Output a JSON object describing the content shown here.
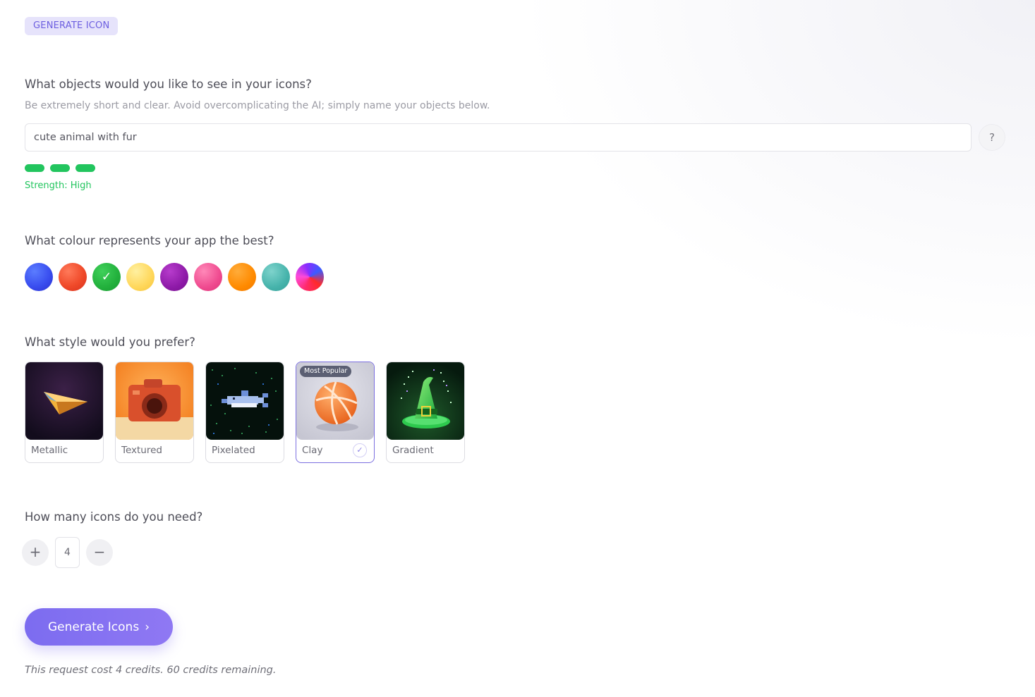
{
  "header": {
    "badge": "GENERATE ICON"
  },
  "objects": {
    "question": "What objects would you like to see in your icons?",
    "hint": "Be extremely short and clear. Avoid overcomplicating the AI; simply name your objects below.",
    "value": "cute animal with fur",
    "help_label": "?",
    "strength_label": "Strength: High",
    "strength_level": 3
  },
  "colour": {
    "question": "What colour represents your app the best?",
    "swatches": [
      {
        "name": "blue",
        "color": "#3a4ff0"
      },
      {
        "name": "red",
        "color": "#f04a2a"
      },
      {
        "name": "green",
        "color": "#22b03c",
        "selected": true
      },
      {
        "name": "yellow",
        "color": "#ffd75a"
      },
      {
        "name": "purple",
        "color": "#8e1aa8"
      },
      {
        "name": "pink",
        "color": "#ef4a8f"
      },
      {
        "name": "orange",
        "color": "#ff8a00"
      },
      {
        "name": "teal",
        "color": "#46b3ab"
      },
      {
        "name": "multicolor",
        "color": "#c42bd8"
      }
    ],
    "selected_check": "✓"
  },
  "style": {
    "question": "What style would you prefer?",
    "cards": [
      {
        "label": "Metallic"
      },
      {
        "label": "Textured"
      },
      {
        "label": "Pixelated"
      },
      {
        "label": "Clay",
        "tag": "Most Popular",
        "selected": true
      },
      {
        "label": "Gradient"
      }
    ],
    "check": "✓"
  },
  "count": {
    "question": "How many icons do you need?",
    "plus": "+",
    "minus": "−",
    "value": "4"
  },
  "actions": {
    "generate_label": "Generate Icons",
    "generate_chevron": "›",
    "cost_note": "This request cost 4 credits. 60 credits remaining."
  },
  "colors": {
    "accent": "#7c6cf0",
    "success": "#22c55e"
  }
}
